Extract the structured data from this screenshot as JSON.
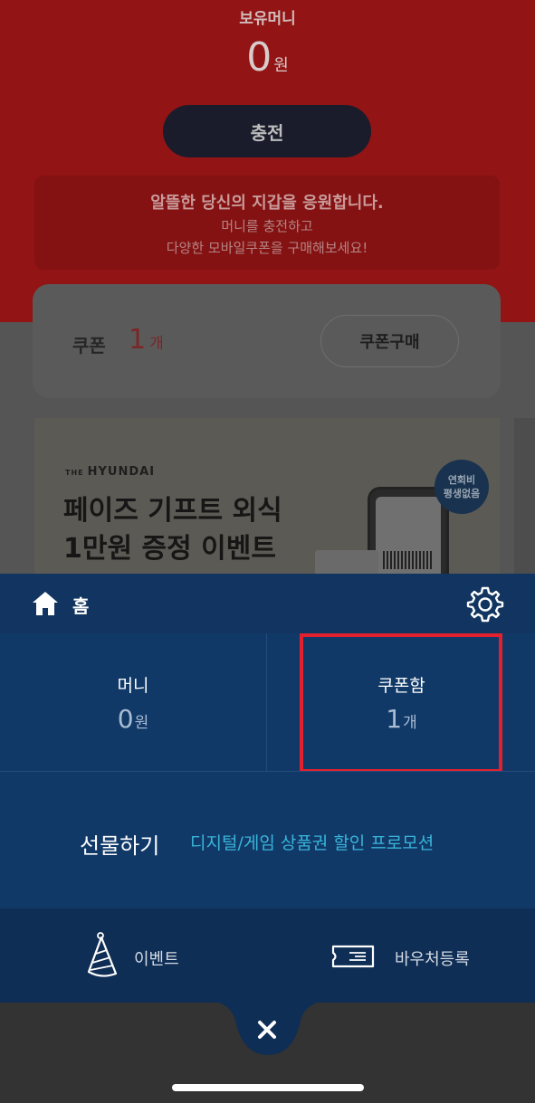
{
  "background": {
    "balance_label": "보유머니",
    "balance_value": "0",
    "balance_unit": "원",
    "charge_button": "충전",
    "promo_line1": "알뜰한 당신의 지갑을 응원합니다.",
    "promo_line2": "머니를 충전하고",
    "promo_line3": "다양한 모바일쿠폰을 구매해보세요!",
    "coupon_label": "쿠폰",
    "coupon_count": "1",
    "coupon_unit": "개",
    "coupon_buy_button": "쿠폰구매",
    "banner": {
      "brand_prefix": "THE",
      "brand": "HYUNDAI",
      "title_line1": "페이즈 기프트 외식",
      "title_line2": "1만원 증정 이벤트",
      "badge_line1": "연회비",
      "badge_line2": "평생없음"
    }
  },
  "menu": {
    "home_label": "홈",
    "money_label": "머니",
    "money_value": "0",
    "money_unit": "원",
    "coupon_box_label": "쿠폰함",
    "coupon_box_value": "1",
    "coupon_box_unit": "개",
    "gift_label": "선물하기",
    "gift_promo": "디지털/게임 상품권 할인 프로모션",
    "event_label": "이벤트",
    "voucher_label": "바우처등록"
  },
  "colors": {
    "menu_bg": "#113968",
    "menu_header": "#113560",
    "highlight": "#e3202d",
    "promo_link": "#39b4d9"
  },
  "icons": [
    "home-icon",
    "gear-icon",
    "party-hat-icon",
    "ticket-icon",
    "close-icon"
  ]
}
